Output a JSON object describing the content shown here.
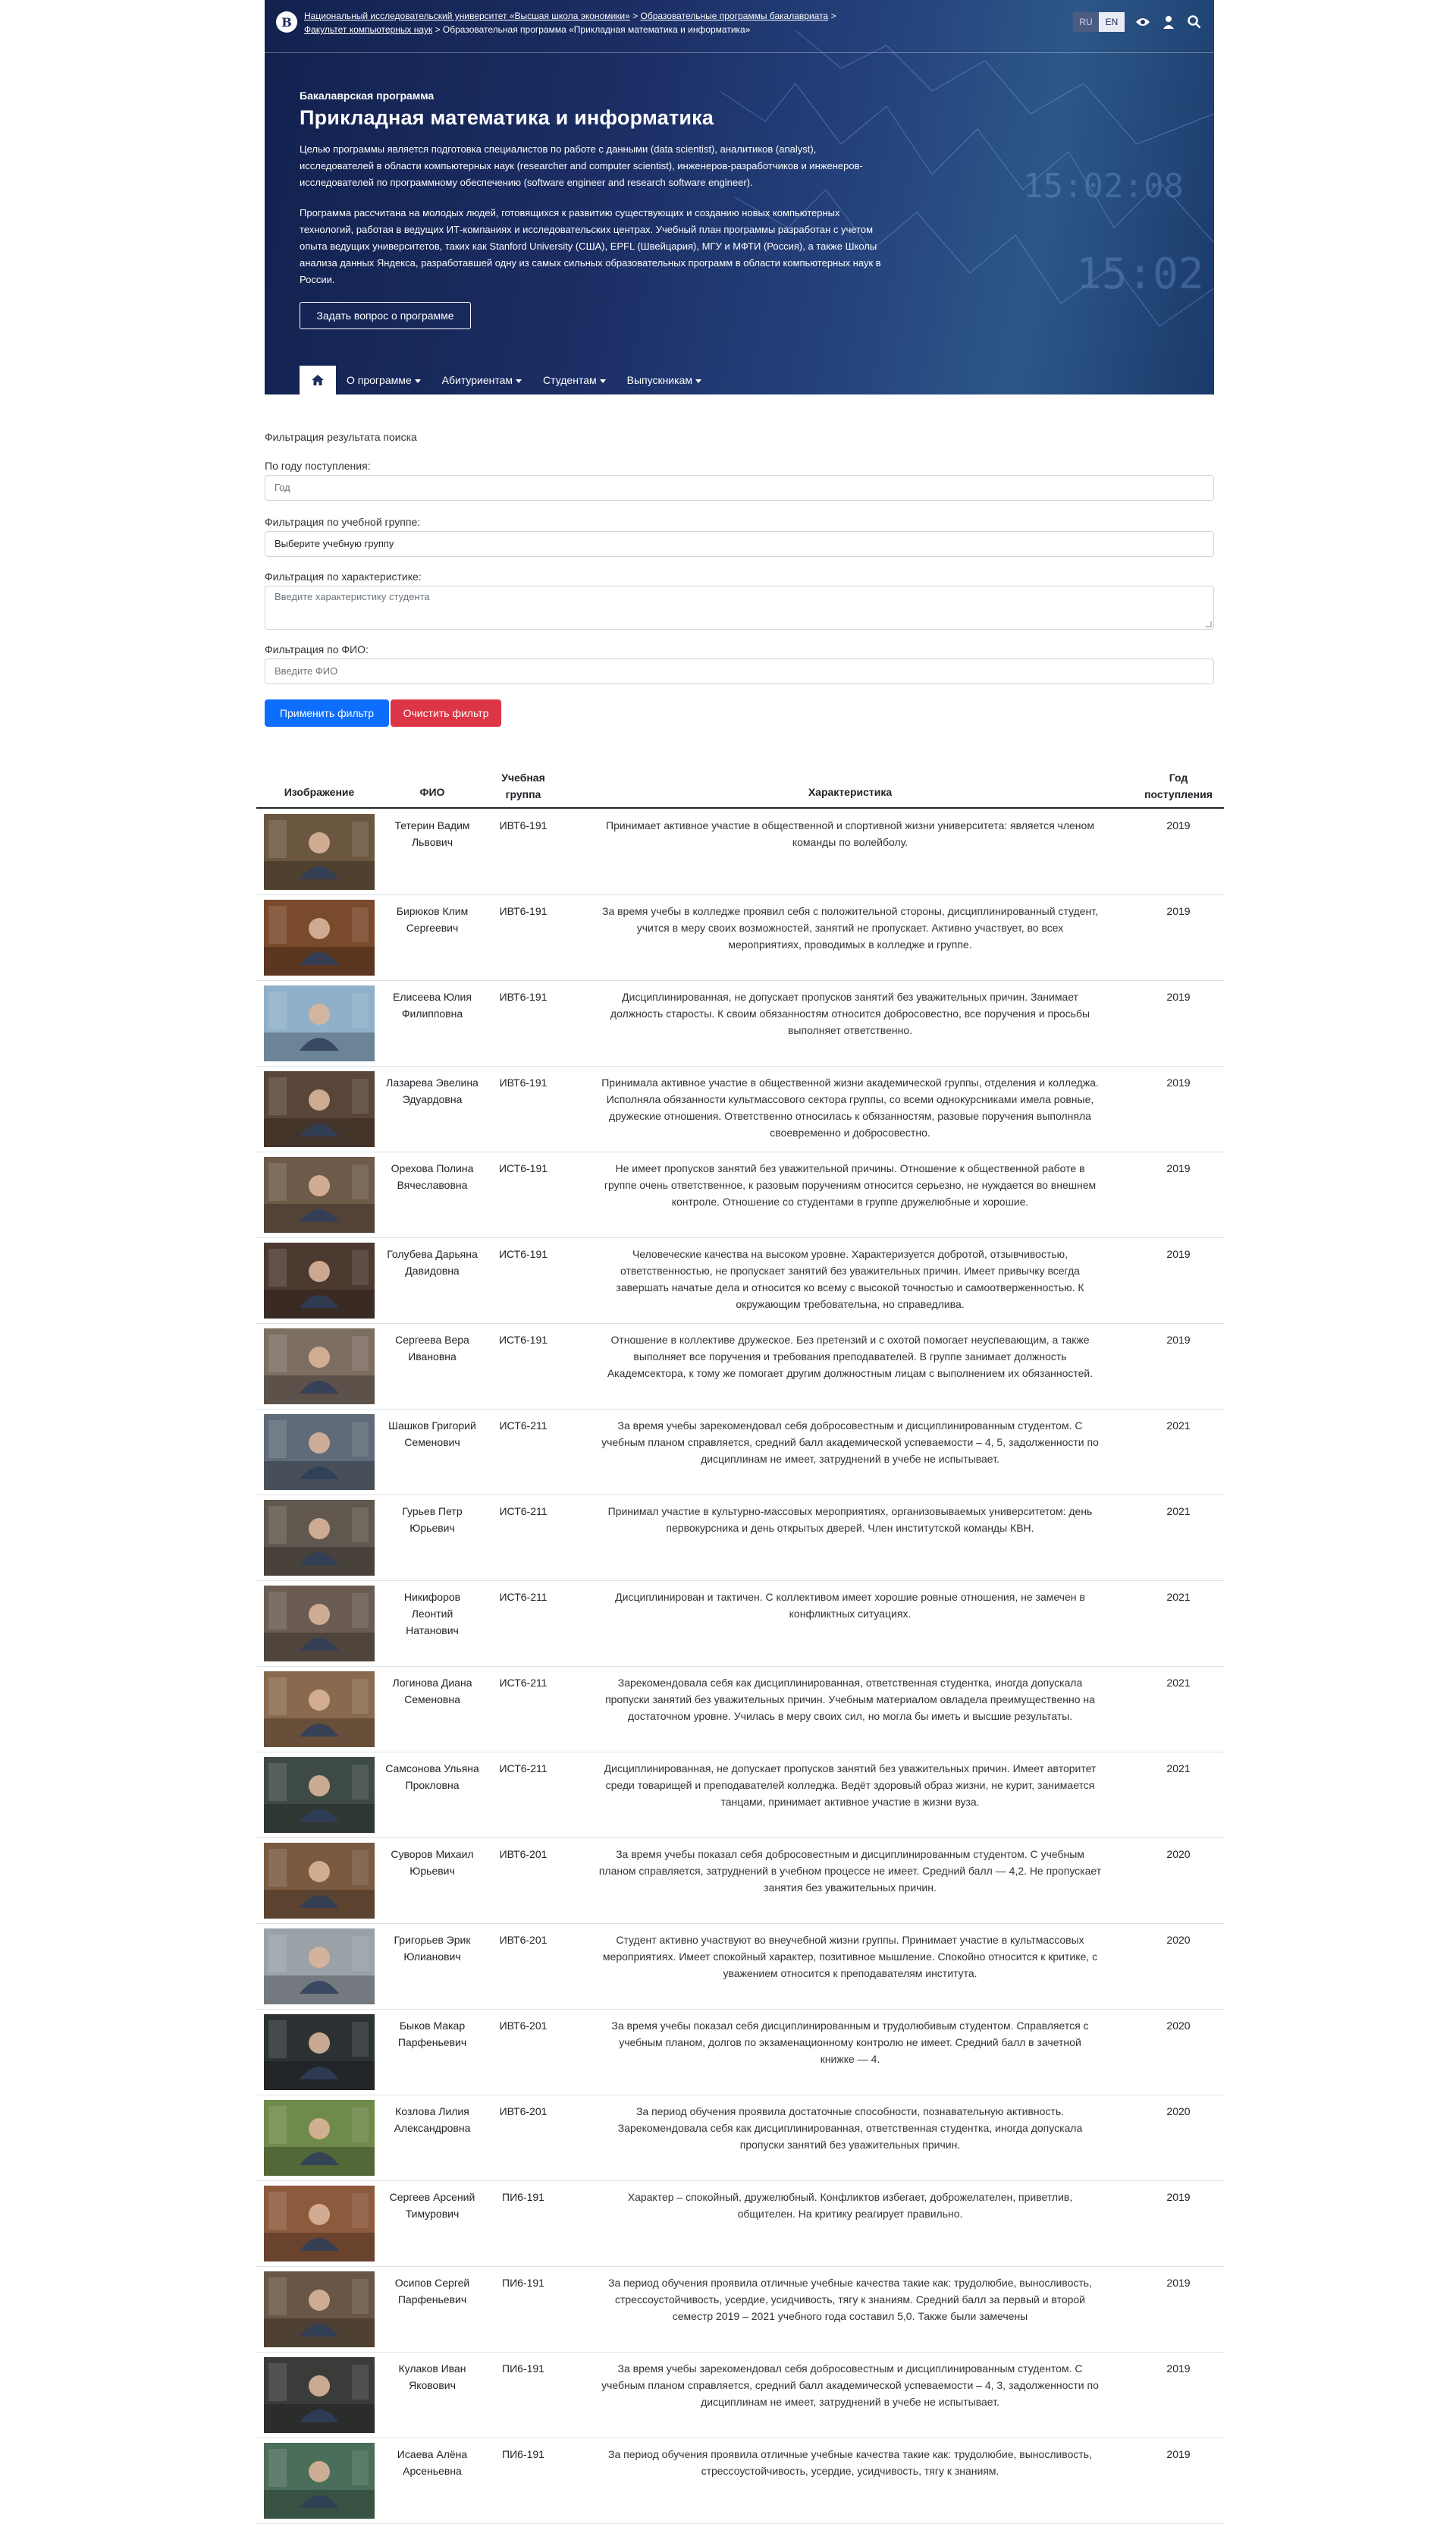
{
  "header": {
    "breadcrumbs": [
      "Национальный исследовательский университет «Высшая школа экономики»",
      "Образовательные программы бакалавриата",
      "Факультет компьютерных наук",
      "Образовательная программа «Прикладная математика и информатика»"
    ],
    "sep": ">",
    "lang_ru": "RU",
    "lang_en": "EN"
  },
  "hero": {
    "subtitle": "Бакалаврская программа",
    "title": "Прикладная математика и информатика",
    "p1": "Целью программы является подготовка специалистов по работе с данными (data scientist), аналитиков (analyst), исследователей в области компьютерных наук (researcher and computer scientist), инженеров-разработчиков и инженеров-исследователей по программному обеспечению (software engineer and research software engineer).",
    "p2": "Программа рассчитана на молодых людей, готовящихся к развитию существующих и созданию новых компьютерных технологий, работая в ведущих ИТ-компаниях и исследовательских центрах. Учебный план программы разработан с учетом опыта ведущих университетов, таких как Stanford University (США), EPFL (Швейцария), МГУ и МФТИ (Россия), а также Школы анализа данных Яндекса, разработавшей одну из самых сильных образовательных программ в области компьютерных наук в России.",
    "ask_button": "Задать вопрос о программе",
    "nav": [
      "О программе",
      "Абитуриентам",
      "Студентам",
      "Выпускникам"
    ]
  },
  "filter": {
    "title": "Фильтрация результата поиска",
    "year_label": "По году поступления:",
    "year_placeholder": "Год",
    "group_label": "Фильтрация по учебной группе:",
    "group_value": "Выберите учебную группу",
    "char_label": "Фильтрация по характеристике:",
    "char_placeholder": "Введите характеристику студента",
    "fio_label": "Фильтрация по ФИО:",
    "fio_placeholder": "Введите ФИО",
    "apply": "Применить фильтр",
    "clear": "Очистить фильтр"
  },
  "table": {
    "headers": {
      "image": "Изображение",
      "fio": "ФИО",
      "group1": "Учебная",
      "group2": "группа",
      "char": "Характеристика",
      "year1": "Год",
      "year2": "поступления"
    },
    "rows": [
      {
        "name": [
          "Тетерин Вадим",
          "Львович"
        ],
        "group": "ИВТ6-191",
        "year": "2019",
        "desc": [
          "Принимает активное участие в общественной и спортивной жизни университета: является членом",
          "команды по волейболу."
        ],
        "tone": "#6b5640"
      },
      {
        "name": [
          "Бирюков Клим",
          "Сергеевич"
        ],
        "group": "ИВТ6-191",
        "year": "2019",
        "desc": [
          "За время учебы в колледже проявил себя с положительной стороны, дисциплинированный студент,",
          "учится в меру своих возможностей, занятий не пропускает. Активно участвует, во всех",
          "мероприятиях, проводимых в колледже и группе."
        ],
        "tone": "#7a4a2c"
      },
      {
        "name": [
          "Елисеева Юлия",
          "Филипповна"
        ],
        "group": "ИВТ6-191",
        "year": "2019",
        "desc": [
          "Дисциплинированная, не допускает пропусков занятий без уважительных причин. Занимает",
          "должность старосты. К своим обязанностям относится добросовестно, все поручения и просьбы",
          "выполняет ответственно."
        ],
        "tone": "#8fb0c8"
      },
      {
        "name": [
          "Лазарева Эвелина",
          "Эдуардовна"
        ],
        "group": "ИВТ6-191",
        "year": "2019",
        "desc": [
          "Принимала активное участие в общественной жизни академической группы, отделения и колледжа.",
          "Исполняла обязанности культмассового сектора группы, со всеми однокурсниками имела ровные,",
          "дружеские отношения. Ответственно относилась к обязанностям, разовые поручения выполняла",
          "своевременно и добросовестно."
        ],
        "tone": "#5a4638"
      },
      {
        "name": [
          "Орехова Полина",
          "Вячеславовна"
        ],
        "group": "ИСТ6-191",
        "year": "2019",
        "desc": [
          "Не имеет пропусков занятий без уважительной причины. Отношение к общественной работе в",
          "группе очень ответственное, к разовым поручениям относится серьезно, не нуждается во внешнем",
          "контроле. Отношение со студентами в группе дружелюбные и хорошие."
        ],
        "tone": "#6e5a48"
      },
      {
        "name": [
          "Голубева Дарьяна",
          "Давидовна"
        ],
        "group": "ИСТ6-191",
        "year": "2019",
        "desc": [
          "Человеческие качества на высоком уровне. Характеризуется добротой, отзывчивостью,",
          "ответственностью, не пропускает занятий без уважительных причин. Имеет привычку всегда",
          "завершать начатые дела и относится ко всему с высокой точностью и самоотверженностью. К",
          "окружающим требовательна, но справедлива."
        ],
        "tone": "#4c3a30"
      },
      {
        "name": [
          "Сергеева Вера",
          "Ивановна"
        ],
        "group": "ИСТ6-191",
        "year": "2019",
        "desc": [
          "Отношение в коллективе дружеское. Без претензий и с охотой помогает неуспевающим, а также",
          "выполняет все поручения и требования преподавателей. В группе занимает должность",
          "Академсектора, к тому же помогает другим должностным лицам с выполнением их обязанностей."
        ],
        "tone": "#7d6e62"
      },
      {
        "name": [
          "Шашков Григорий",
          "Семенович"
        ],
        "group": "ИСТ6-211",
        "year": "2021",
        "desc": [
          "За время учебы зарекомендовал себя добросовестным и дисциплинированным студентом. С",
          "учебным планом справляется, средний балл академической успеваемости – 4, 5, задолженности по",
          "дисциплинам не имеет, затруднений в учебе не испытывает."
        ],
        "tone": "#5f6b78"
      },
      {
        "name": [
          "Гурьев Петр",
          "Юрьевич"
        ],
        "group": "ИСТ6-211",
        "year": "2021",
        "desc": [
          "Принимал участие в культурно-массовых мероприятиях, организовываемых университетом: день",
          "первокурсника и день открытых дверей. Член институтской команды КВН."
        ],
        "tone": "#60584e"
      },
      {
        "name": [
          "Никифоров",
          "Леонтий",
          "Натанович"
        ],
        "group": "ИСТ6-211",
        "year": "2021",
        "desc": [
          "Дисциплинирован и тактичен. С коллективом имеет хорошие ровные отношения, не замечен в",
          "конфликтных ситуациях."
        ],
        "tone": "#6a5c52"
      },
      {
        "name": [
          "Логинова Диана",
          "Семеновна"
        ],
        "group": "ИСТ6-211",
        "year": "2021",
        "desc": [
          "Зарекомендовала себя как дисциплинированная, ответственная студентка, иногда допускала",
          "пропуски занятий без уважительных причин. Учебным материалом овладела преимущественно на",
          "достаточном уровне. Училась в меру своих сил, но могла бы иметь и высшие результаты."
        ],
        "tone": "#8a6a4e"
      },
      {
        "name": [
          "Самсонова Ульяна",
          "Прокловна"
        ],
        "group": "ИСТ6-211",
        "year": "2021",
        "desc": [
          "Дисциплинированная, не допускает пропусков занятий без уважительных причин. Имеет авторитет",
          "среди товарищей и преподавателей колледжа. Ведёт здоровый образ жизни, не курит, занимается",
          "танцами, принимает активное участие в жизни вуза."
        ],
        "tone": "#3e4a46"
      },
      {
        "name": [
          "Суворов Михаил",
          "Юрьевич"
        ],
        "group": "ИВТ6-201",
        "year": "2020",
        "desc": [
          "За время учебы показал себя добросовестным и дисциплинированным студентом. С учебным",
          "планом справляется, затруднений в учебном процессе не имеет. Средний балл — 4,2. Не пропускает",
          "занятия без уважительных причин."
        ],
        "tone": "#7a5a40"
      },
      {
        "name": [
          "Григорьев Эрик",
          "Юлианович"
        ],
        "group": "ИВТ6-201",
        "year": "2020",
        "desc": [
          "Студент активно участвуют во внеучебной жизни группы. Принимает участие в культмассовых",
          "мероприятиях. Имеет спокойный характер, позитивное мышление. Спокойно относится к критике, с",
          "уважением относится к преподавателям института."
        ],
        "tone": "#9aa2a8"
      },
      {
        "name": [
          "Быков Макар",
          "Парфеньевич"
        ],
        "group": "ИВТ6-201",
        "year": "2020",
        "desc": [
          "За время учебы показал себя дисциплинированным и трудолюбивым студентом. Справляется с",
          "учебным планом, долгов по экзаменационному контролю не имеет. Средний балл в зачетной",
          "книжке — 4."
        ],
        "tone": "#2c3234"
      },
      {
        "name": [
          "Козлова Лилия",
          "Александровна"
        ],
        "group": "ИВТ6-201",
        "year": "2020",
        "desc": [
          "За период обучения проявила достаточные способности, познавательную активность.",
          "Зарекомендовала себя как дисциплинированная, ответственная студентка, иногда допускала",
          "пропуски занятий без уважительных причин."
        ],
        "tone": "#6f8a4a"
      },
      {
        "name": [
          "Сергеев Арсений",
          "Тимурович"
        ],
        "group": "ПИ6-191",
        "year": "2019",
        "desc": [
          "Характер – спокойный, дружелюбный. Конфликтов избегает, доброжелателен, приветлив,",
          "общителен. На критику реагирует правильно."
        ],
        "tone": "#8c5a3c"
      },
      {
        "name": [
          "Осипов Сергей",
          "Парфеньевич"
        ],
        "group": "ПИ6-191",
        "year": "2019",
        "desc": [
          "За период обучения проявила отличные учебные качества такие как: трудолюбие, выносливость,",
          "стрессоустойчивость, усердие, усидчивость, тягу к знаниям. Средний балл за первый и второй",
          "семестр 2019 – 2021 учебного года составил 5,0. Также были замечены"
        ],
        "tone": "#6a5646"
      },
      {
        "name": [
          "Кулаков Иван",
          "Яковович"
        ],
        "group": "ПИ6-191",
        "year": "2019",
        "desc": [
          "За время учебы зарекомендовал себя добросовестным и дисциплинированным студентом. С",
          "учебным планом справляется, средний балл академической успеваемости – 4, 3, задолженности по",
          "дисциплинам не имеет, затруднений в учебе не испытывает."
        ],
        "tone": "#3a3c3a"
      },
      {
        "name": [
          "Исаева Алёна",
          "Арсеньевна"
        ],
        "group": "ПИ6-191",
        "year": "2019",
        "desc": [
          "За период обучения проявила отличные учебные качества такие как: трудолюбие, выносливость,",
          "стрессоустойчивость, усердие, усидчивость, тягу к знаниям."
        ],
        "tone": "#4a6e5a"
      }
    ]
  }
}
